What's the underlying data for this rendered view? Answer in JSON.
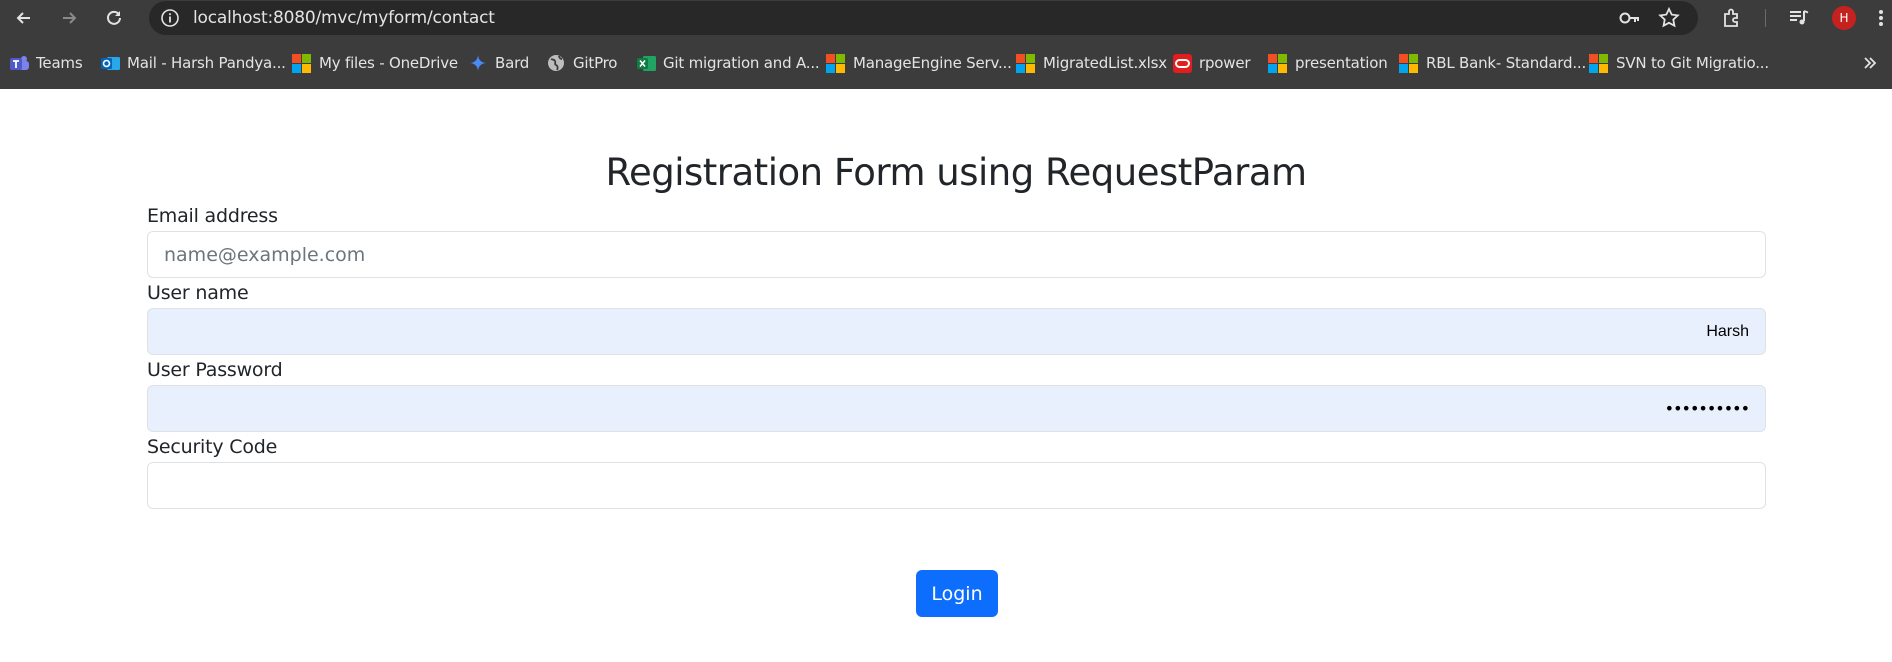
{
  "browser": {
    "url": "localhost:8080/mvc/myform/contact",
    "profile_initial": "H",
    "bookmarks": [
      {
        "label": "Teams",
        "icon": "teams-icon"
      },
      {
        "label": "Mail - Harsh Pandya...",
        "icon": "outlook-icon"
      },
      {
        "label": "My files - OneDrive",
        "icon": "microsoft-icon"
      },
      {
        "label": "Bard",
        "icon": "bard-icon"
      },
      {
        "label": "GitPro",
        "icon": "globe-icon"
      },
      {
        "label": "Git migration and A...",
        "icon": "excel-icon"
      },
      {
        "label": "ManageEngine Serv...",
        "icon": "microsoft-icon"
      },
      {
        "label": "MigratedList.xlsx",
        "icon": "microsoft-icon"
      },
      {
        "label": "rpower",
        "icon": "oracle-icon"
      },
      {
        "label": "presentation",
        "icon": "microsoft-icon"
      },
      {
        "label": "RBL Bank- Standard...",
        "icon": "microsoft-icon"
      },
      {
        "label": "SVN to Git Migratio...",
        "icon": "microsoft-icon"
      }
    ]
  },
  "form": {
    "title": "Registration Form using RequestParam",
    "email_label": "Email address",
    "email_placeholder": "name@example.com",
    "username_label": "User name",
    "username_value": "Harsh",
    "password_label": "User Password",
    "password_mask": "••••••••••",
    "security_label": "Security Code",
    "security_value": "",
    "submit_label": "Login"
  },
  "colors": {
    "chrome_bg": "#3c3c3c",
    "omnibox_bg": "#282828",
    "autofill_bg": "#e8f0fe",
    "primary_button": "#0d6efd",
    "avatar": "#c5221f"
  }
}
